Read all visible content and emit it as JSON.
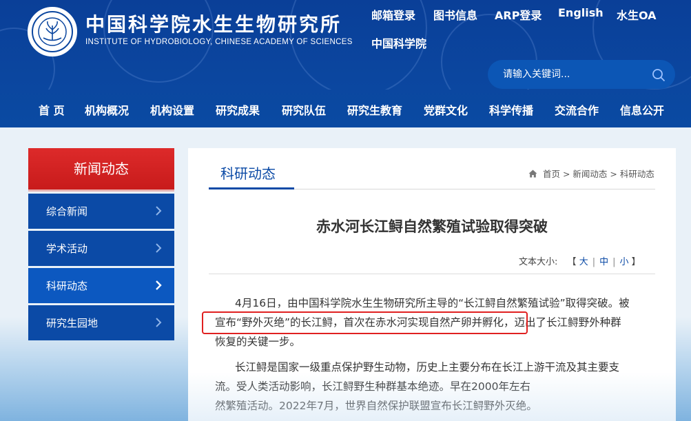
{
  "header": {
    "title_cn": "中国科学院水生生物研究所",
    "title_en": "INSTITUTE OF HYDROBIOLOGY, CHINESE ACADEMY OF SCIENCES",
    "logo_icon": "institute-seal-icon",
    "brand_color": "#0b469f"
  },
  "top_links": [
    "邮箱登录",
    "图书信息",
    "ARP登录",
    "English",
    "水生OA",
    "中国科学院"
  ],
  "search": {
    "placeholder": "请输入关键词..."
  },
  "nav": [
    "首 页",
    "机构概况",
    "机构设置",
    "研究成果",
    "研究队伍",
    "研究生教育",
    "党群文化",
    "科学传播",
    "交流合作",
    "信息公开"
  ],
  "sidebar": {
    "heading": "新闻动态",
    "heading_color": "#d42323",
    "items": [
      "综合新闻",
      "学术活动",
      "科研动态",
      "研究生园地"
    ],
    "active": "科研动态"
  },
  "content": {
    "section_title": "科研动态",
    "breadcrumb": "首页 > 新闻动态 > 科研动态",
    "article_title": "赤水河长江鲟自然繁殖试验取得突破",
    "font_size": {
      "label": "文本大小:",
      "open": "【",
      "close": "】",
      "options": [
        "大",
        "中",
        "小"
      ]
    },
    "paragraphs": [
      "4月16日，由中国科学院水生生物研究所主导的“长江鲟自然繁殖试验”取得突破。被",
      "宣布“野外灭绝”的长江鲟，首次在赤水河实现自然产卵并孵化，迈出了长江鲟野外种群",
      "恢复的关键一步。",
      "长江鲟是国家一级重点保护野生动物，历史上主要分布在长江上游干流及其主要支",
      "流。受人类活动影响，长江鲟野生种群基本绝迹。早在2000年左右",
      "然繁殖活动。2022年7月，世界自然保护联盟宣布长江鲟野外灭绝。"
    ],
    "highlight_color": "#e02020"
  }
}
